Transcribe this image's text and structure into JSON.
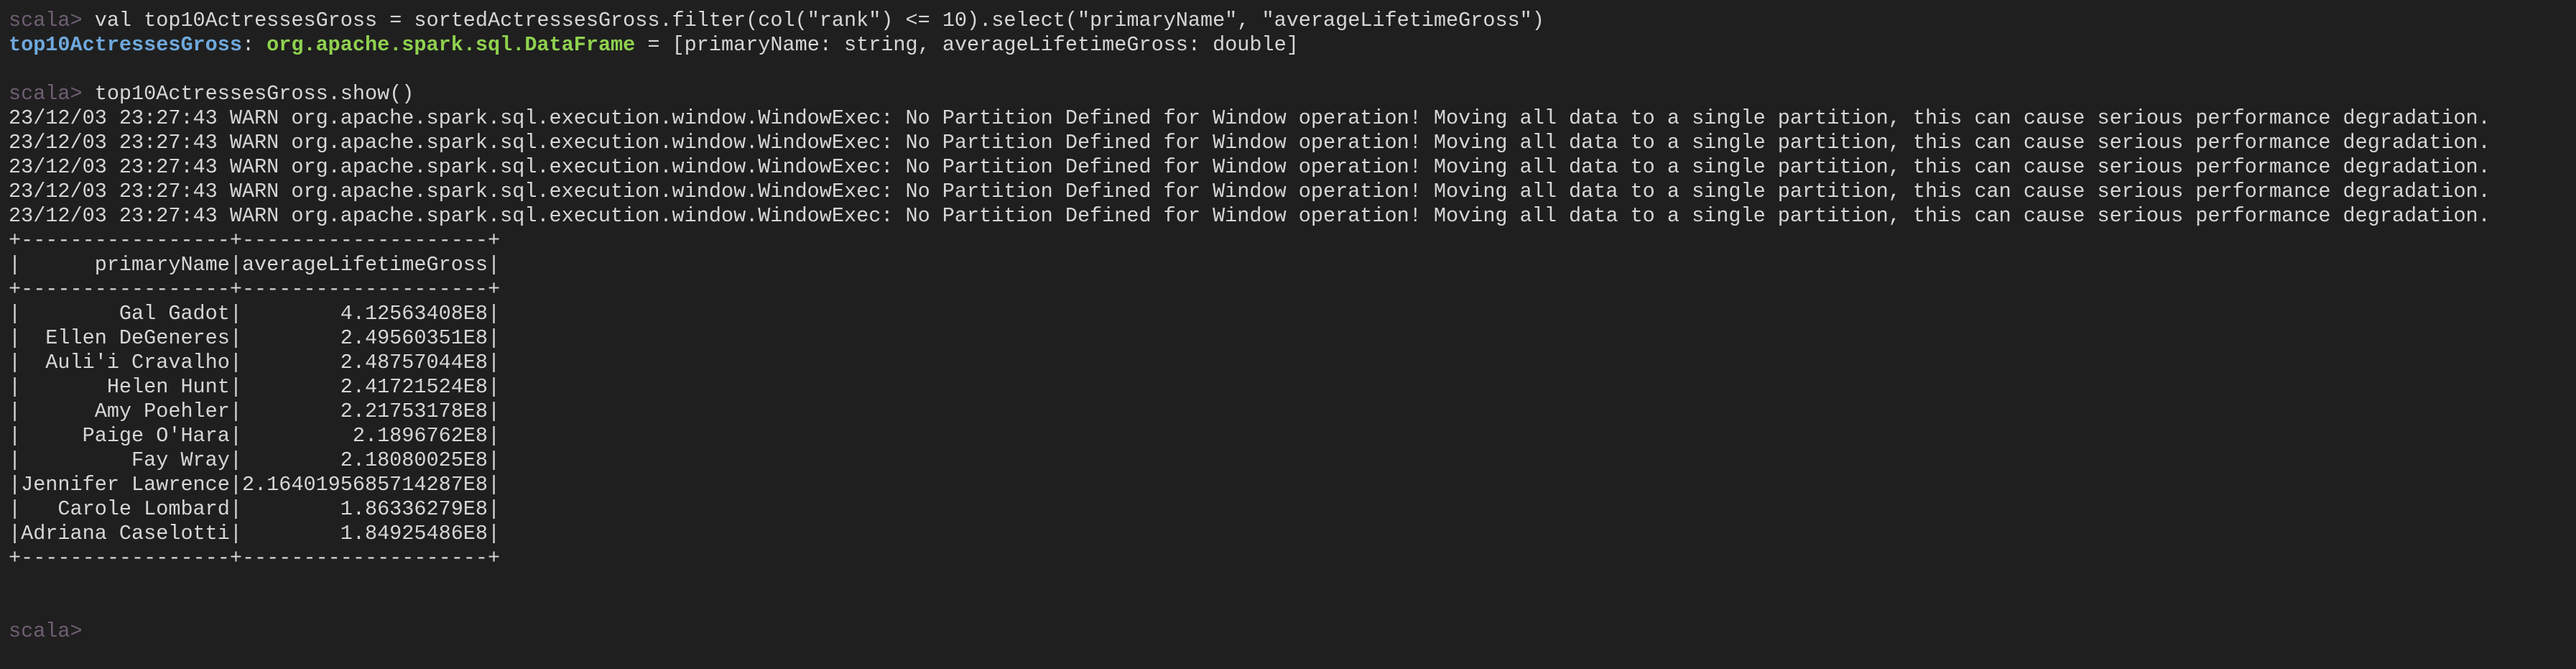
{
  "colors": {
    "background": "#1f1f1f",
    "text": "#d6d6d6",
    "prompt": "#6e5e73",
    "variable": "#6fa8dc",
    "type": "#8fd14f"
  },
  "prompt": "scala>",
  "command1": {
    "code": " val top10ActressesGross = sortedActressesGross.filter(col(\"rank\") <= 10).select(\"primaryName\", \"averageLifetimeGross\")"
  },
  "result1": {
    "var": "top10ActressesGross",
    "sep": ": ",
    "type": "org.apache.spark.sql.DataFrame",
    "rest": " = [primaryName: string, averageLifetimeGross: double]"
  },
  "command2": {
    "code": " top10ActressesGross.show()"
  },
  "warnings": [
    "23/12/03 23:27:43 WARN org.apache.spark.sql.execution.window.WindowExec: No Partition Defined for Window operation! Moving all data to a single partition, this can cause serious performance degradation.",
    "23/12/03 23:27:43 WARN org.apache.spark.sql.execution.window.WindowExec: No Partition Defined for Window operation! Moving all data to a single partition, this can cause serious performance degradation.",
    "23/12/03 23:27:43 WARN org.apache.spark.sql.execution.window.WindowExec: No Partition Defined for Window operation! Moving all data to a single partition, this can cause serious performance degradation.",
    "23/12/03 23:27:43 WARN org.apache.spark.sql.execution.window.WindowExec: No Partition Defined for Window operation! Moving all data to a single partition, this can cause serious performance degradation.",
    "23/12/03 23:27:43 WARN org.apache.spark.sql.execution.window.WindowExec: No Partition Defined for Window operation! Moving all data to a single partition, this can cause serious performance degradation."
  ],
  "table": {
    "border": "+-----------------+--------------------+",
    "header": "|      primaryName|averageLifetimeGross|",
    "rows": [
      "|        Gal Gadot|        4.12563408E8|",
      "|  Ellen DeGeneres|        2.49560351E8|",
      "|  Auli'i Cravalho|        2.48757044E8|",
      "|       Helen Hunt|        2.41721524E8|",
      "|      Amy Poehler|        2.21753178E8|",
      "|     Paige O'Hara|         2.1896762E8|",
      "|         Fay Wray|        2.18080025E8|",
      "|Jennifer Lawrence|2.1640195685714287E8|",
      "|   Carole Lombard|        1.86336279E8|",
      "|Adriana Caselotti|        1.84925486E8|"
    ]
  }
}
